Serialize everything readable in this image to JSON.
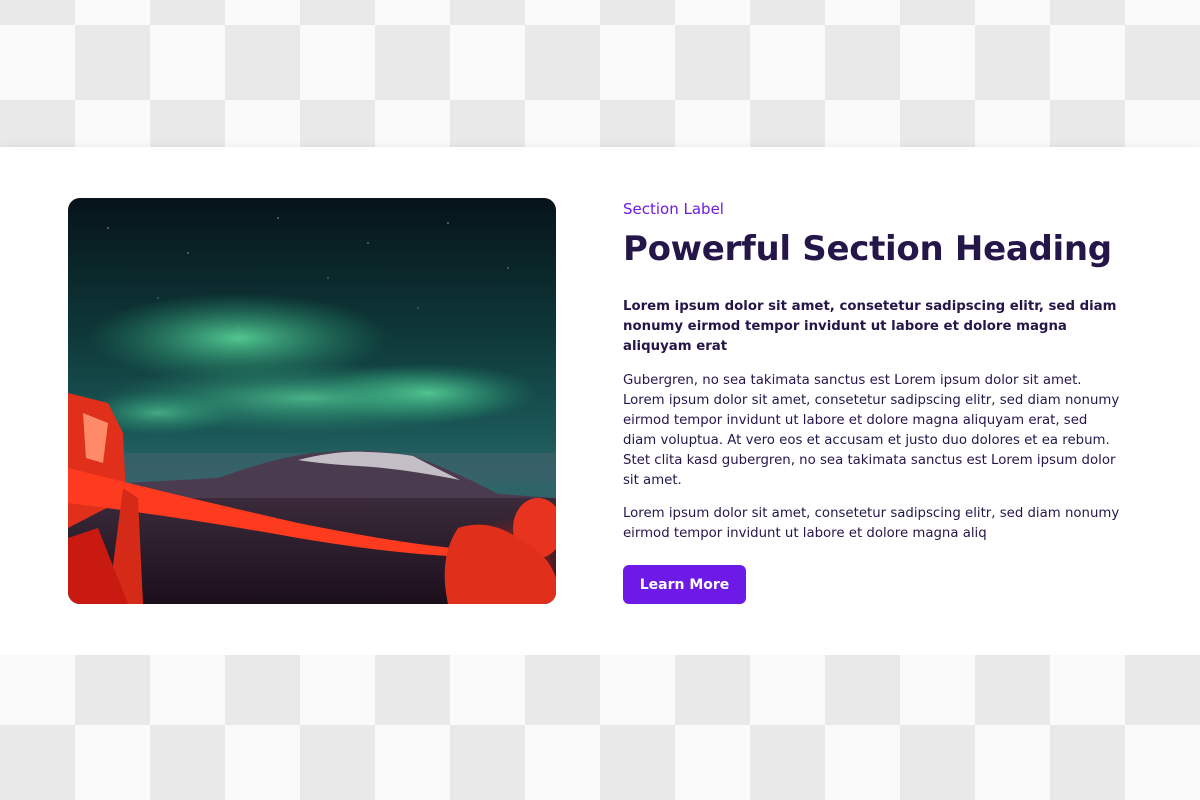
{
  "section": {
    "label": "Section Label",
    "heading": "Powerful Section Heading",
    "lead": "Lorem ipsum dolor sit amet, consetetur sadipscing elitr, sed diam nonumy eirmod tempor invidunt ut labore et dolore magna aliquyam erat",
    "paragraphs": [
      "Gubergren, no sea takimata sanctus est Lorem ipsum dolor sit amet. Lorem ipsum dolor sit amet, consetetur sadipscing elitr, sed diam nonumy eirmod tempor invidunt ut labore et dolore magna aliquyam erat, sed diam voluptua. At vero eos et accusam et justo duo dolores et ea rebum. Stet clita kasd gubergren, no sea takimata sanctus est Lorem ipsum dolor sit amet.",
      "Lorem ipsum dolor sit amet, consetetur sadipscing elitr, sed diam nonumy eirmod tempor invidunt ut labore et dolore magna aliq"
    ],
    "button_label": "Learn More"
  },
  "colors": {
    "accent": "#6d1ae6",
    "text_dark": "#25164a"
  }
}
